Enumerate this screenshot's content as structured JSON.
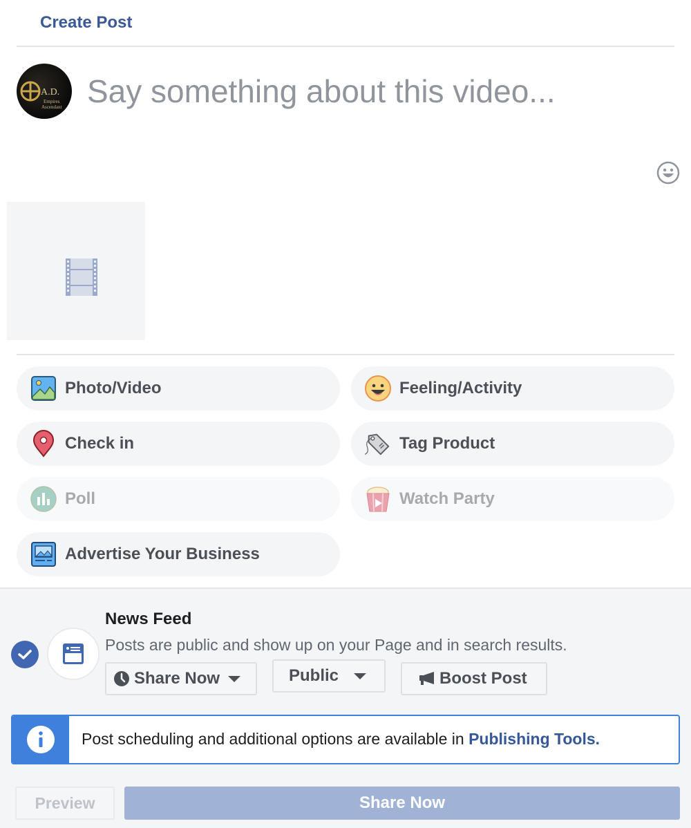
{
  "header": {
    "title": "Create Post"
  },
  "composer": {
    "placeholder": "Say something about this video...",
    "value": "",
    "avatar": {
      "brand_text": "A.D.",
      "subtitle_line1": "Empires",
      "subtitle_line2": "Ascendant"
    }
  },
  "attachment": {
    "type": "video",
    "icon": "film-strip-icon"
  },
  "actions": [
    {
      "label": "Photo/Video",
      "icon": "photo-video-icon",
      "enabled": true
    },
    {
      "label": "Feeling/Activity",
      "icon": "feeling-emoji-icon",
      "enabled": true
    },
    {
      "label": "Check in",
      "icon": "location-pin-icon",
      "enabled": true
    },
    {
      "label": "Tag Product",
      "icon": "price-tag-icon",
      "enabled": true
    },
    {
      "label": "Poll",
      "icon": "poll-chart-icon",
      "enabled": false
    },
    {
      "label": "Watch Party",
      "icon": "popcorn-icon",
      "enabled": false
    },
    {
      "label": "Advertise Your Business",
      "icon": "advertise-icon",
      "enabled": true
    }
  ],
  "destination": {
    "checked": true,
    "title": "News Feed",
    "description": "Posts are public and show up on your Page and in search results.",
    "schedule_dropdown": "Share Now",
    "audience_dropdown": "Public",
    "boost_label": "Boost Post"
  },
  "info": {
    "text": "Post scheduling and additional options are available in ",
    "link": "Publishing Tools."
  },
  "footer": {
    "preview_label": "Preview",
    "share_label": "Share Now"
  },
  "colors": {
    "brand": "#3b5998",
    "checkbox": "#4267b2",
    "info_accent": "#4080dd",
    "share_disabled": "#a0b3d6"
  }
}
